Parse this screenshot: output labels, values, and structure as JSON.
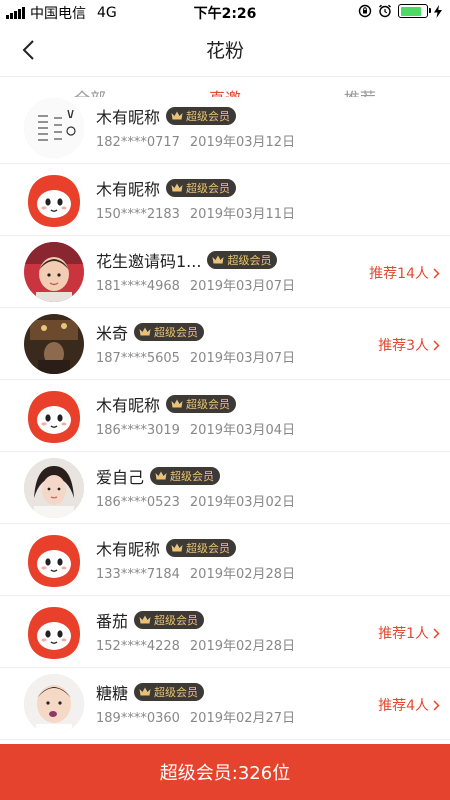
{
  "status_bar": {
    "carrier": "中国电信",
    "network": "4G",
    "time": "下午2:26",
    "battery_level": 0.8
  },
  "header": {
    "title": "花粉",
    "back_icon": "chevron-left-icon"
  },
  "tabs": [
    {
      "label": "全部",
      "active": false
    },
    {
      "label": "直邀",
      "active": true
    },
    {
      "label": "推荐",
      "active": false
    }
  ],
  "members": [
    {
      "name": "木有昵称",
      "badge": "超级会员",
      "phone": "182****0717",
      "date": "2019年03月12日",
      "avatar": "doodle-avatar",
      "referral": ""
    },
    {
      "name": "木有昵称",
      "badge": "超级会员",
      "phone": "150****2183",
      "date": "2019年03月11日",
      "avatar": "mascot-avatar",
      "referral": ""
    },
    {
      "name": "花生邀请码1...",
      "badge": "超级会员",
      "phone": "181****4968",
      "date": "2019年03月07日",
      "avatar": "baby-photo-avatar",
      "referral": "推荐14人"
    },
    {
      "name": "米奇",
      "badge": "超级会员",
      "phone": "187****5605",
      "date": "2019年03月07日",
      "avatar": "dark-photo-avatar",
      "referral": "推荐3人"
    },
    {
      "name": "木有昵称",
      "badge": "超级会员",
      "phone": "186****3019",
      "date": "2019年03月04日",
      "avatar": "mascot-avatar",
      "referral": ""
    },
    {
      "name": "爱自己",
      "badge": "超级会员",
      "phone": "186****0523",
      "date": "2019年03月02日",
      "avatar": "woman-photo-avatar",
      "referral": ""
    },
    {
      "name": "木有昵称",
      "badge": "超级会员",
      "phone": "133****7184",
      "date": "2019年02月28日",
      "avatar": "mascot-avatar",
      "referral": ""
    },
    {
      "name": "番茄",
      "badge": "超级会员",
      "phone": "152****4228",
      "date": "2019年02月28日",
      "avatar": "mascot-avatar",
      "referral": "推荐1人"
    },
    {
      "name": "糖糖",
      "badge": "超级会员",
      "phone": "189****0360",
      "date": "2019年02月27日",
      "avatar": "child-photo-avatar",
      "referral": "推荐4人"
    }
  ],
  "footer": {
    "summary": "超级会员:326位"
  },
  "colors": {
    "accent": "#e44a32",
    "footer_bg": "#e5432e",
    "badge_bg": "#3d3a35",
    "badge_text": "#e9c27a",
    "mascot_red": "#e8402a"
  }
}
